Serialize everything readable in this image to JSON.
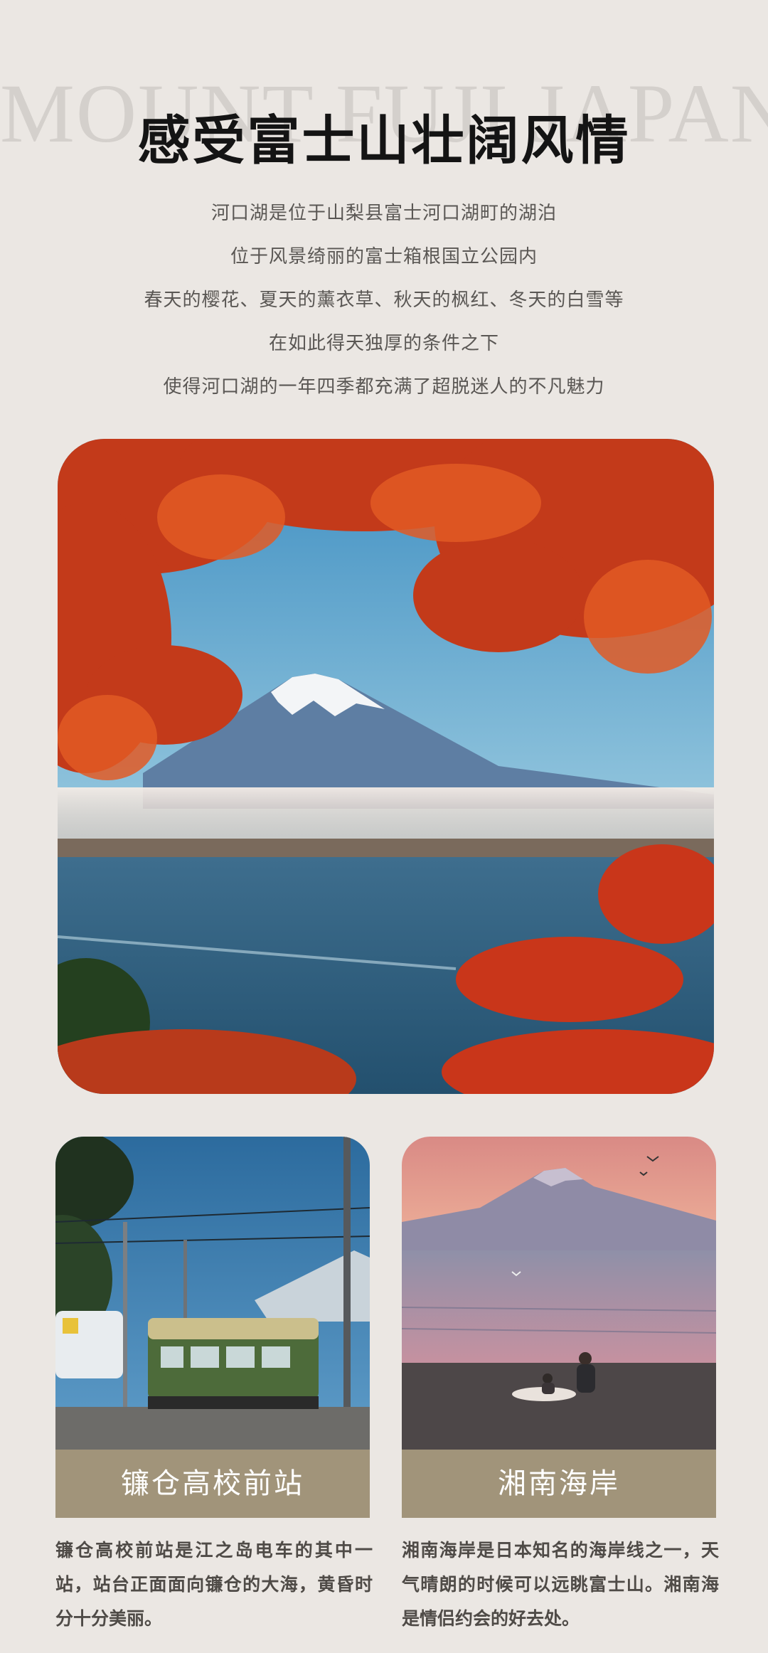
{
  "header": {
    "bg_title": "MOUNT FUJI JAPAN",
    "title": "感受富士山壮阔风情"
  },
  "intro": {
    "lines": [
      "河口湖是位于山梨县富士河口湖町的湖泊",
      "位于风景绮丽的富士箱根国立公园内",
      "春天的樱花、夏天的薰衣草、秋天的枫红、冬天的白雪等",
      "在如此得天独厚的条件之下",
      "使得河口湖的一年四季都充满了超脱迷人的不凡魅力"
    ]
  },
  "hero": {
    "icon": "mount-fuji-autumn-photo"
  },
  "cards": [
    {
      "title": "镰仓高校前站",
      "description": "镰仓高校前站是江之岛电车的其中一站，站台正面面向镰仓的大海，黄昏时分十分美丽。",
      "icon": "enoden-train-photo"
    },
    {
      "title": "湘南海岸",
      "description": "湘南海岸是日本知名的海岸线之一，天气晴朗的时候可以远眺富士山。湘南海是情侣约会的好去处。",
      "icon": "shonan-beach-photo"
    }
  ],
  "colors": {
    "background": "#ebe7e3",
    "label_bar": "#a1947a",
    "title": "#141414"
  }
}
